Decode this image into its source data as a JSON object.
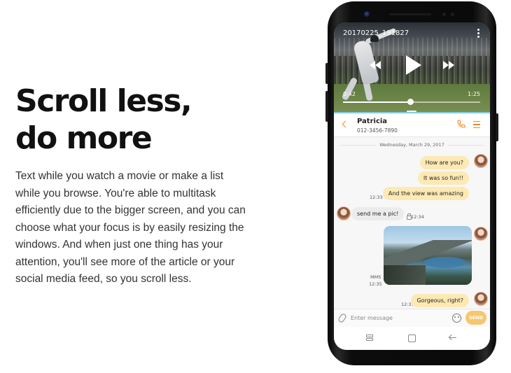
{
  "marketing": {
    "headline_line1": "Scroll less,",
    "headline_line2": "do more",
    "body": "Text while you watch a movie or make a list while you browse. You're able to multitask efficiently due to the bigger screen, and you can choose what your focus is by easily resizing the windows. And when just one thing has your attention, you'll see more of the article or your social media feed, so you scroll less."
  },
  "video": {
    "title": "20170225_191827",
    "elapsed": "0:42",
    "total": "1:25",
    "progress": 0.49,
    "icons": [
      "more-vertical-icon",
      "rewind-icon",
      "play-icon",
      "fast-forward-icon"
    ]
  },
  "chat": {
    "contact_name": "Patricia",
    "contact_phone": "012-3456-7890",
    "date": "Wednesday, March 29, 2017",
    "messages": [
      {
        "dir": "out",
        "text": "How are you?"
      },
      {
        "dir": "out",
        "text": "It was so fun!!"
      },
      {
        "dir": "out",
        "text": "And the view was amazing",
        "time": "12:33"
      },
      {
        "dir": "in",
        "text": "send me a pic!",
        "time": "12:34"
      },
      {
        "dir": "out",
        "type": "mms",
        "label": "MMS",
        "time": "12:35"
      },
      {
        "dir": "out",
        "text": "Gorgeous, right?",
        "time": "12:37"
      }
    ]
  },
  "compose": {
    "placeholder": "Enter message",
    "send_label": "SEND"
  },
  "colors": {
    "accent": "#ee8a2a",
    "bubble_out": "#fde9b3",
    "bubble_in": "#ececec",
    "send_button": "#f6c770",
    "split_bar": "#87cbe3"
  }
}
